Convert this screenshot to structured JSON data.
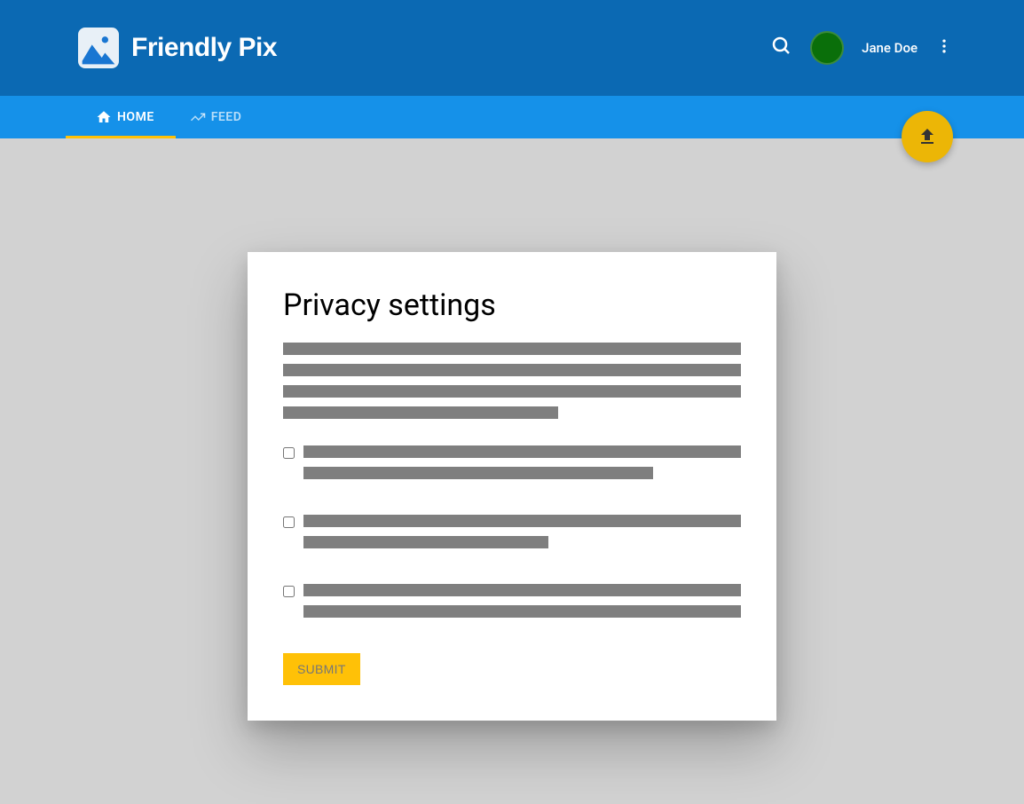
{
  "header": {
    "app_name": "Friendly Pix",
    "user_name": "Jane Doe"
  },
  "nav": {
    "tabs": [
      {
        "label": "HOME",
        "icon": "home",
        "active": true
      },
      {
        "label": "FEED",
        "icon": "trending",
        "active": false
      }
    ]
  },
  "card": {
    "title": "Privacy settings",
    "submit_label": "SUBMIT",
    "checkboxes": [
      {
        "checked": false
      },
      {
        "checked": false
      },
      {
        "checked": false
      }
    ]
  }
}
